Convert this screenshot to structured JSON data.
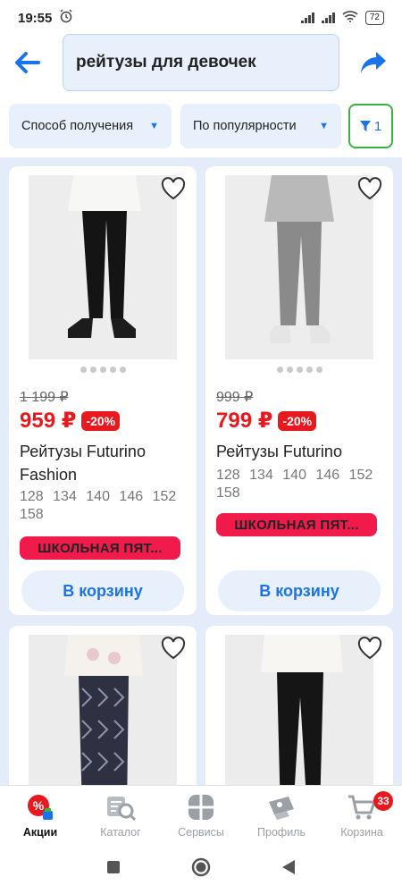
{
  "status_bar": {
    "time": "19:55",
    "battery": "72"
  },
  "search": {
    "query": "рейтузы для девочек"
  },
  "filters": {
    "delivery_label": "Способ получения",
    "sort_label": "По популярности",
    "active_count": "1"
  },
  "products": [
    {
      "old_price": "1 199 ₽",
      "price": "959 ₽",
      "discount": "-20%",
      "title": "Рейтузы Futurino Fashion",
      "sizes": "128 134 140 146 152 158",
      "badge": "ШКОЛЬНАЯ ПЯТ...",
      "cart_label": "В корзину"
    },
    {
      "old_price": "999 ₽",
      "price": "799 ₽",
      "discount": "-20%",
      "title": "Рейтузы Futurino",
      "sizes": "128 134 140 146 152 158",
      "badge": "ШКОЛЬНАЯ ПЯТ...",
      "cart_label": "В корзину"
    }
  ],
  "bottom_nav": {
    "items": [
      {
        "label": "Акции",
        "icon": "percent-badge-icon"
      },
      {
        "label": "Каталог",
        "icon": "catalog-search-icon"
      },
      {
        "label": "Сервисы",
        "icon": "services-grid-icon"
      },
      {
        "label": "Профиль",
        "icon": "profile-icon"
      },
      {
        "label": "Корзина",
        "icon": "cart-icon"
      }
    ],
    "cart_count": "33"
  },
  "colors": {
    "accent": "#1a73e8",
    "price_red": "#e8191e",
    "badge_pink": "#f01a4b",
    "filter_active": "#3cb043",
    "tile_bg": "#e3ecf8"
  }
}
